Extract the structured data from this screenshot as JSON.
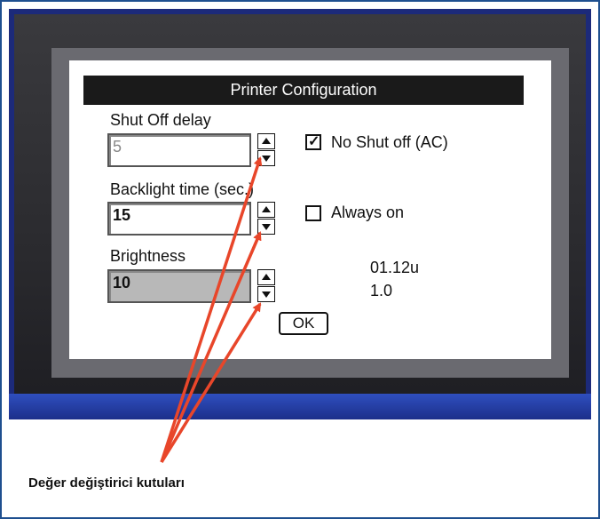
{
  "dialog": {
    "title": "Printer Configuration",
    "shutoff_label": "Shut Off delay",
    "shutoff_value": "5",
    "backlight_label": "Backlight time (sec.)",
    "backlight_value": "15",
    "brightness_label": "Brightness",
    "brightness_value": "10",
    "no_shutoff_label": "No Shut off (AC)",
    "no_shutoff_checked": true,
    "always_on_label": "Always on",
    "always_on_checked": false,
    "version_1": "01.12u",
    "version_2": "1.0",
    "ok_label": "OK"
  },
  "caption": "Değer değiştirici kutuları",
  "colors": {
    "arrow": "#e8462a",
    "bezel": "#1c2a7a",
    "frame_border": "#1e4f8f"
  }
}
